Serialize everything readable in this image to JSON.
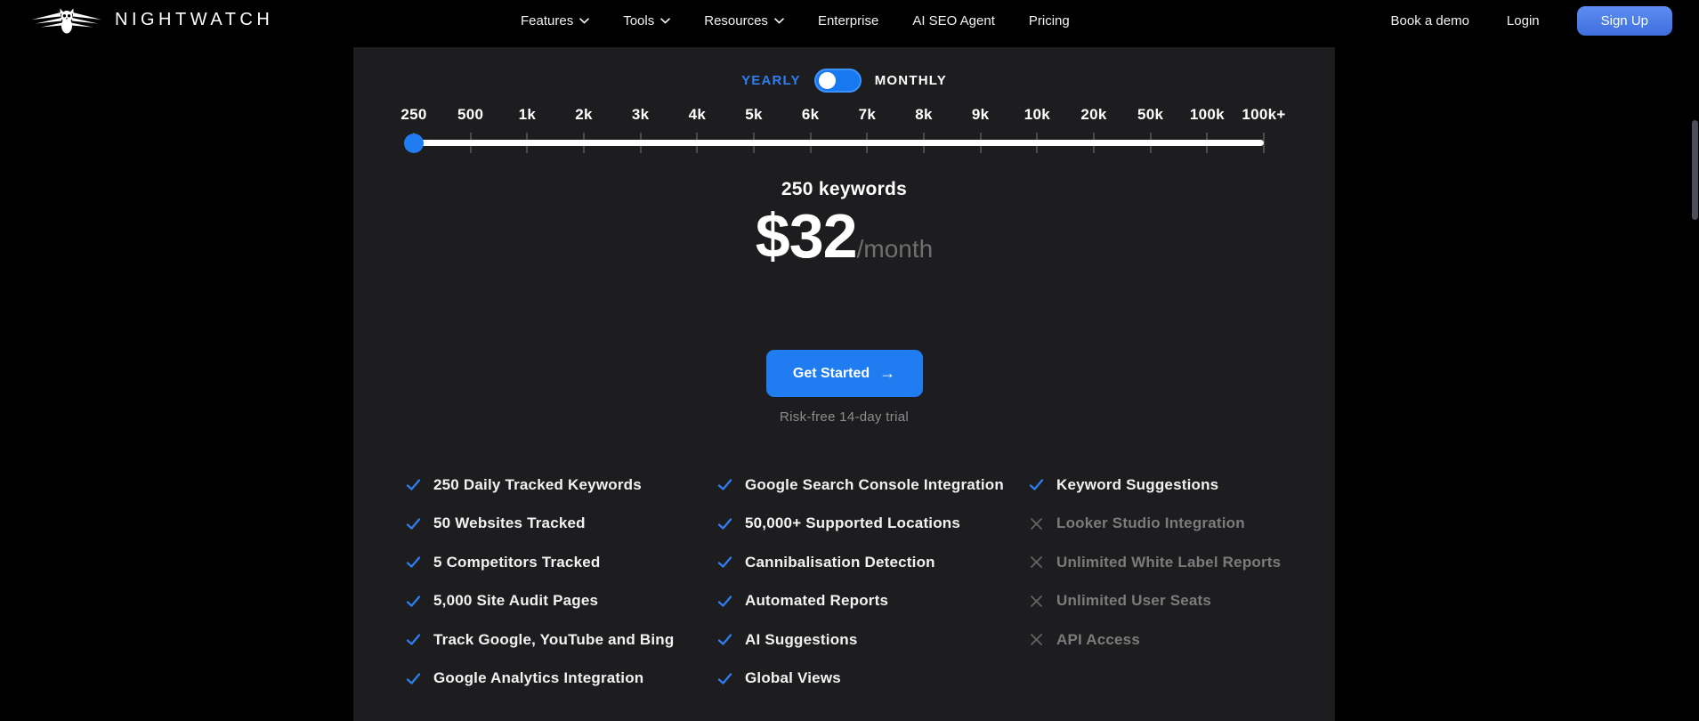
{
  "brand": {
    "name": "NIGHTWATCH"
  },
  "nav": {
    "items": [
      {
        "label": "Features",
        "dropdown": true
      },
      {
        "label": "Tools",
        "dropdown": true
      },
      {
        "label": "Resources",
        "dropdown": true
      },
      {
        "label": "Enterprise",
        "dropdown": false
      },
      {
        "label": "AI SEO Agent",
        "dropdown": false
      },
      {
        "label": "Pricing",
        "dropdown": false
      }
    ],
    "book_demo": "Book a demo",
    "login": "Login",
    "signup": "Sign Up"
  },
  "billing_toggle": {
    "yearly_label": "YEARLY",
    "monthly_label": "MONTHLY",
    "selected": "yearly"
  },
  "keyword_slider": {
    "stops": [
      "250",
      "500",
      "1k",
      "2k",
      "3k",
      "4k",
      "5k",
      "6k",
      "7k",
      "8k",
      "9k",
      "10k",
      "20k",
      "50k",
      "100k",
      "100k+"
    ],
    "selected_index": 0,
    "selected_value": "250"
  },
  "plan": {
    "keywords_label": "250 keywords",
    "price": "$32",
    "period": "/month",
    "cta_label": "Get Started",
    "cta_arrow": "→",
    "trial_note": "Risk-free 14-day trial"
  },
  "features": {
    "columns": [
      {
        "items": [
          {
            "label": "250 Daily Tracked Keywords",
            "included": true
          },
          {
            "label": "50 Websites Tracked",
            "included": true
          },
          {
            "label": "5 Competitors Tracked",
            "included": true
          },
          {
            "label": "5,000 Site Audit Pages",
            "included": true
          },
          {
            "label": "Track Google, YouTube and Bing",
            "included": true
          },
          {
            "label": "Google Analytics Integration",
            "included": true
          }
        ]
      },
      {
        "items": [
          {
            "label": "Google Search Console Integration",
            "included": true
          },
          {
            "label": "50,000+ Supported Locations",
            "included": true
          },
          {
            "label": "Cannibalisation Detection",
            "included": true
          },
          {
            "label": "Automated Reports",
            "included": true
          },
          {
            "label": "AI Suggestions",
            "included": true
          },
          {
            "label": "Global Views",
            "included": true
          }
        ]
      },
      {
        "items": [
          {
            "label": "Keyword Suggestions",
            "included": true
          },
          {
            "label": "Looker Studio Integration",
            "included": false
          },
          {
            "label": "Unlimited White Label Reports",
            "included": false
          },
          {
            "label": "Unlimited User Seats",
            "included": false
          },
          {
            "label": "API Access",
            "included": false
          }
        ]
      }
    ]
  },
  "colors": {
    "page_bg": "#000000",
    "panel_bg": "#1d1d1f",
    "accent_blue": "#1f7cf1",
    "yearly_text": "#2e7ef0",
    "signup_blue": "#4a7ce6",
    "muted_text": "#8d8d8d",
    "disabled_text": "#7b7b7b",
    "disabled_icon": "#646464",
    "tick_gray": "#4b4b4b",
    "scrollbar": "#4b5058"
  }
}
